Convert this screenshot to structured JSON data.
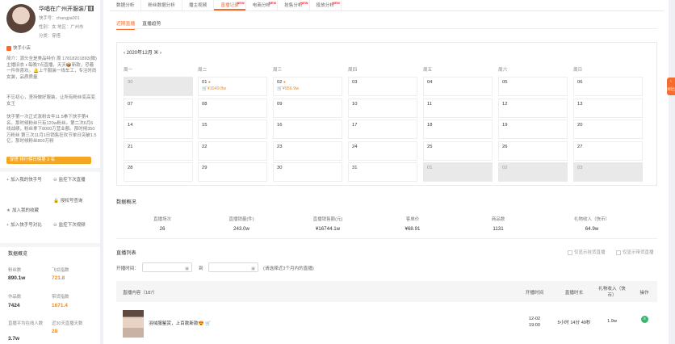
{
  "profile": {
    "name": "华唱在广州开服装厂",
    "kuaishou_no": "快手号：changjia001",
    "gender_region": "性别：女   地区：广州市",
    "category": "分类：穿搭",
    "tag": "快手小店",
    "intro": "简介：源头全是美品特价 周 17818201893(微) 主播旧衣 ◐每晚7点直播，天天📦新款，恐着一件你喜欢。🔔上千服装一线车工，专注时尚女装，品质质量",
    "intro2": "不忘初心，坚持做好服装，让所有粉丝变高变女王",
    "intro3": "快手第一次正式涨粉去年11.5拳下快手第4名，那时候粉丝只有120w粉丝。第二次6月6线战绩，粉丝拿下8000万营业额。那时候350万粉丝 第三次11月1日销售狂欢节单日突破1.5亿，那时候粉丝800万粉",
    "rank_btn": "穿搭 排行榜日榜第 3 名"
  },
  "actions": {
    "add_to_mine": "加入我的快手号",
    "monitor_next": "监控下次直播",
    "add_collect": "加入我的收藏",
    "custom_report": "授权号查询",
    "add_compare": "加入快手号对比",
    "monitor_video": "监控下次视频"
  },
  "overview": {
    "title": "数据概览",
    "labels": [
      "粉丝数",
      "飞瓜指数",
      "作品数",
      "带货指数",
      "直播平均在线人数",
      "近30天直播天数"
    ],
    "values": [
      "890.1w",
      "721.8",
      "7424",
      "1671.4",
      "3.7w",
      "28"
    ]
  },
  "tabs": [
    {
      "label": "数据分析",
      "new": false
    },
    {
      "label": "粉丝数据分析",
      "new": false
    },
    {
      "label": "播主视频",
      "new": false
    },
    {
      "label": "直播记录",
      "new": true
    },
    {
      "label": "电商分析",
      "new": true
    },
    {
      "label": "挂售分析",
      "new": true
    },
    {
      "label": "投放分析",
      "new": true
    }
  ],
  "subtabs": [
    "近期直播",
    "直播趋势"
  ],
  "calendar": {
    "month": "2020年12月",
    "weekdays": [
      "周一",
      "周二",
      "周三",
      "周四",
      "周五",
      "周六",
      "周日"
    ],
    "weeks": [
      [
        {
          "d": "30",
          "g": true
        },
        {
          "d": "01",
          "amt": "¥1549.8w",
          "live": true
        },
        {
          "d": "02",
          "amt": "¥956.9w",
          "live": true
        },
        {
          "d": "03"
        },
        {
          "d": "04"
        },
        {
          "d": "05"
        },
        {
          "d": "06"
        }
      ],
      [
        {
          "d": "07"
        },
        {
          "d": "08"
        },
        {
          "d": "09"
        },
        {
          "d": "10"
        },
        {
          "d": "11"
        },
        {
          "d": "12"
        },
        {
          "d": "13"
        }
      ],
      [
        {
          "d": "14"
        },
        {
          "d": "15"
        },
        {
          "d": "16"
        },
        {
          "d": "17"
        },
        {
          "d": "18"
        },
        {
          "d": "19"
        },
        {
          "d": "20"
        }
      ],
      [
        {
          "d": "21"
        },
        {
          "d": "22"
        },
        {
          "d": "23"
        },
        {
          "d": "24"
        },
        {
          "d": "25"
        },
        {
          "d": "26"
        },
        {
          "d": "27"
        }
      ],
      [
        {
          "d": "28"
        },
        {
          "d": "29"
        },
        {
          "d": "30"
        },
        {
          "d": "31"
        },
        {
          "d": "01",
          "g": true
        },
        {
          "d": "02",
          "g": true
        },
        {
          "d": "03",
          "g": true
        }
      ]
    ]
  },
  "summary": {
    "title": "数据概况",
    "labels": [
      "直播场次",
      "直播销量(件)",
      "直播销售额(元)",
      "客单价",
      "商品数",
      "礼物收入（快币）"
    ],
    "values": [
      "26",
      "243.0w",
      "¥16744.1w",
      "¥68.91",
      "1131",
      "64.9w"
    ]
  },
  "list": {
    "title": "直播列表",
    "time_label": "开播时间：",
    "to": "到",
    "hint": "(请选择近3个月内的直播)",
    "chk_goods": "仅显示挂货直播",
    "chk_gift": "仅显示带货直播",
    "headers": [
      "直播内容（187）",
      "开播时间",
      "直播时长",
      "礼物收入（快币）",
      "操作"
    ],
    "row": {
      "title": "羽绒服鉴赏，上百款新款😍",
      "time": "12-02\n19:00",
      "duration": "5小时 14分 49秒",
      "gift": "1.9w"
    }
  },
  "side_tab": "对比"
}
